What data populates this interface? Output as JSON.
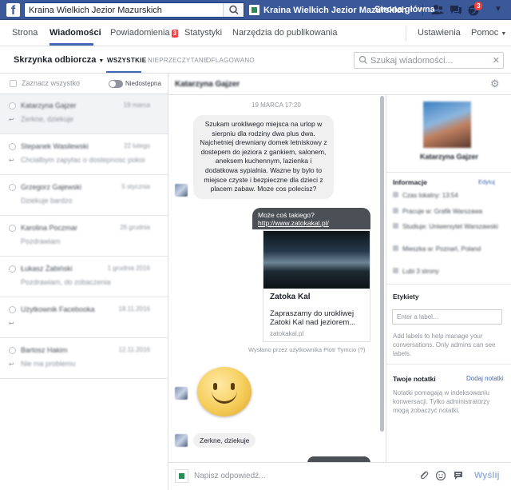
{
  "topbar": {
    "logo_letter": "f",
    "search_value": "Kraina Wielkich Jezior Mazurskich",
    "page_name": "Kraina Wielkich Jezior Mazurskich",
    "home_label": "Strona główna",
    "notification_count": "3"
  },
  "subnav": {
    "tabs": [
      "Strona",
      "Wiadomości",
      "Powiadomienia",
      "Statystyki",
      "Narzędzia do publikowania"
    ],
    "notif_badge": "3",
    "settings": "Ustawienia",
    "help": "Pomoc"
  },
  "filterbar": {
    "inbox_title": "Skrzynka odbiorcza",
    "filters": [
      "WSZYSTKIE",
      "NIEPRZECZYTANE",
      "OFLAGOWANO"
    ],
    "search_placeholder": "Szukaj wiadomości..."
  },
  "left": {
    "select_all": "Zaznacz wszystko",
    "unavailable": "Niedostępna",
    "conversations": [
      {
        "name": "Katarzyna Gajzer",
        "date": "19 marca",
        "snippet": "Zerkne, dziekuje"
      },
      {
        "name": "Stepanek Wasilewski",
        "date": "22 lutego",
        "snippet": "Chcialbym zapytac o dostepnosc pokoi"
      },
      {
        "name": "Grzegorz Gajewski",
        "date": "5 stycznia",
        "snippet": "Dziekuje bardzo"
      },
      {
        "name": "Karolina Poczmar",
        "date": "26 grudnia",
        "snippet": "Pozdrawiam"
      },
      {
        "name": "Łukasz Żabiński",
        "date": "1 grudnia 2016",
        "snippet": "Pozdrawiam, do zobaczenia"
      },
      {
        "name": "Użytkownik Facebooka",
        "date": "18.11.2016",
        "snippet": ""
      },
      {
        "name": "Bartosz Hakim",
        "date": "12.11.2016",
        "snippet": "Nie ma problemu"
      }
    ]
  },
  "chat": {
    "contact_name": "Katarzyna Gajzer",
    "date_separator": "19 MARCA 17:20",
    "incoming_message": "Szukam urokliwego miejsca na urlop w sierpniu dla rodziny dwa plus dwa. Najchetniej drewniany domek letniskowy z dostepem do jeziora z gankiem, salonem, aneksem kuchennym, lazienka i dodatkowa sypialnia. Wazne by bylo to miejsce czyste i bezpieczne dla dzieci z placem zabaw. Moze cos polecisz?",
    "outgoing_text": "Może coś takiego?",
    "outgoing_link": "http://www.zatokakal.pl/",
    "card_title": "Zatoka Kal",
    "card_desc": "Zapraszamy do urokliwej Zatoki Kal nad jeziorem...",
    "card_url": "zatokakal.pl",
    "sent_by": "Wysłano przez użytkownika Piotr Tymcio (?)",
    "reply_message": "Zerkne, dziekuje",
    "reply_placeholder": "Napisz odpowiedź...",
    "send_label": "Wyślij"
  },
  "profile": {
    "name": "Katarzyna Gajzer",
    "info_title": "Informacje",
    "info_action": "Edytuj",
    "info_rows": [
      "Czas lokalny: 13:54",
      "Pracuje w: Grafik Warszawa",
      "Studiuje: Uniwersytet Warszawski",
      "Mieszka w: Poznań, Poland",
      "Lubi 3 strony"
    ],
    "labels_title": "Etykiety",
    "label_placeholder": "Enter a label...",
    "labels_help": "Add labels to help manage your conversations. Only admins can see labels.",
    "notes_title": "Twoje notatki",
    "notes_add": "Dodaj notatki",
    "notes_help": "Notatki pomagają w indeksowaniu konwersacji. Tylko administratorzy mogą zobaczyć notatki."
  },
  "colors": {
    "brand": "#3b5998",
    "accent": "#4267b2",
    "badge": "#fa3e3e"
  }
}
